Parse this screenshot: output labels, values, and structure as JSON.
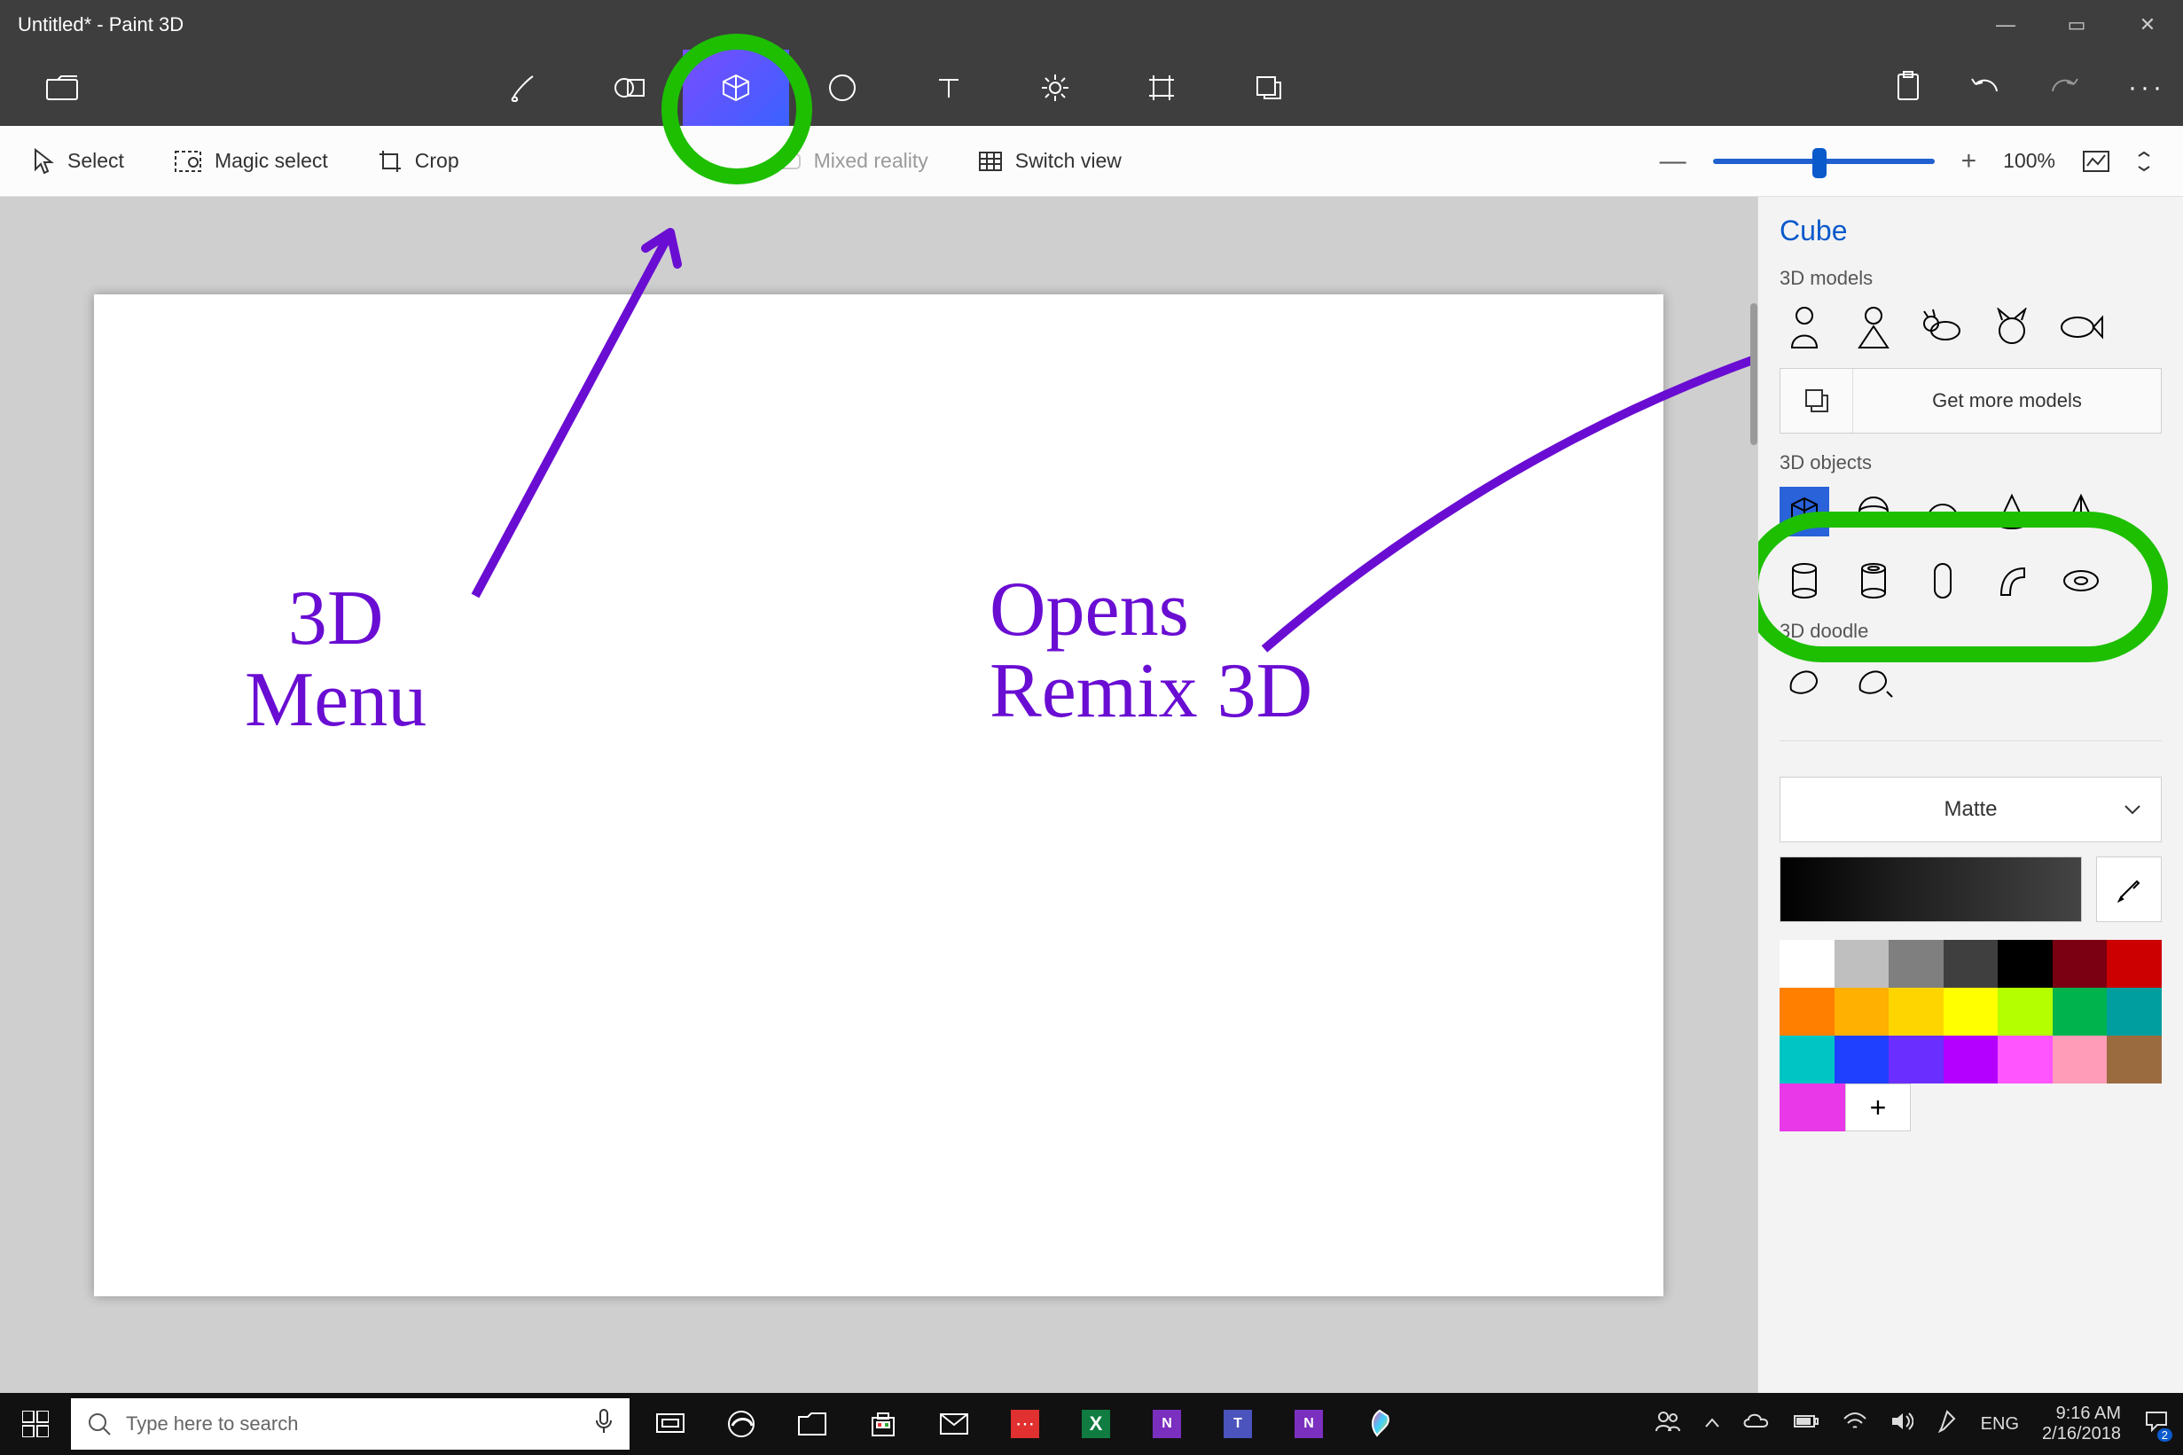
{
  "titlebar": {
    "title": "Untitled* - Paint 3D"
  },
  "window_controls": {
    "min": "—",
    "max": "▭",
    "close": "✕"
  },
  "toolbar": {
    "items": [
      {
        "name": "menu-file-icon"
      },
      {
        "name": "brushes-icon"
      },
      {
        "name": "2d-shapes-icon"
      },
      {
        "name": "3d-shapes-icon",
        "selected": true
      },
      {
        "name": "stickers-icon"
      },
      {
        "name": "text-icon"
      },
      {
        "name": "effects-icon"
      },
      {
        "name": "canvas-crop-icon"
      },
      {
        "name": "remix3d-icon"
      }
    ],
    "right": [
      {
        "name": "paste-icon"
      },
      {
        "name": "undo-icon"
      },
      {
        "name": "redo-icon"
      },
      {
        "name": "more-icon"
      }
    ]
  },
  "subtoolbar": {
    "select": "Select",
    "magic_select": "Magic select",
    "crop": "Crop",
    "mixed_reality": "Mixed reality",
    "switch_view": "Switch view",
    "zoom_minus": "—",
    "zoom_plus": "+",
    "zoom_text": "100%"
  },
  "sidepanel": {
    "title": "Cube",
    "section_models": "3D models",
    "models": [
      "man-icon",
      "woman-icon",
      "dog-icon",
      "cat-icon",
      "fish-icon"
    ],
    "get_more": "Get more models",
    "section_objects": "3D objects",
    "objects": [
      "cube-icon",
      "sphere-icon",
      "hemisphere-icon",
      "cone-icon",
      "pyramid-icon",
      "cylinder-icon",
      "tube-icon",
      "capsule-icon",
      "curved-cylinder-icon",
      "doughnut-icon"
    ],
    "section_doodle": "3D doodle",
    "doodles": [
      "soft-edge-doodle-icon",
      "sharp-edge-doodle-icon"
    ],
    "material": "Matte",
    "palette": [
      "#ffffff",
      "#bfbfbf",
      "#7f7f7f",
      "#3f3f3f",
      "#000000",
      "#7a0012",
      "#cc0000",
      "#ff7f00",
      "#ffb000",
      "#ffd500",
      "#ffff00",
      "#b4ff00",
      "#00b34d",
      "#009e9e",
      "#00c5c5",
      "#2040ff",
      "#6a2fff",
      "#b300ff",
      "#ff55ff",
      "#ff9cb7",
      "#9a6b3f"
    ],
    "add_color_swatch": "#e838e8"
  },
  "annotations": {
    "text1": "3D\nMenu",
    "text2": "Opens\nRemix 3D"
  },
  "taskbar": {
    "search_placeholder": "Type here to search",
    "lang": "ENG",
    "time": "9:16 AM",
    "date": "2/16/2018",
    "notif_count": "2"
  }
}
